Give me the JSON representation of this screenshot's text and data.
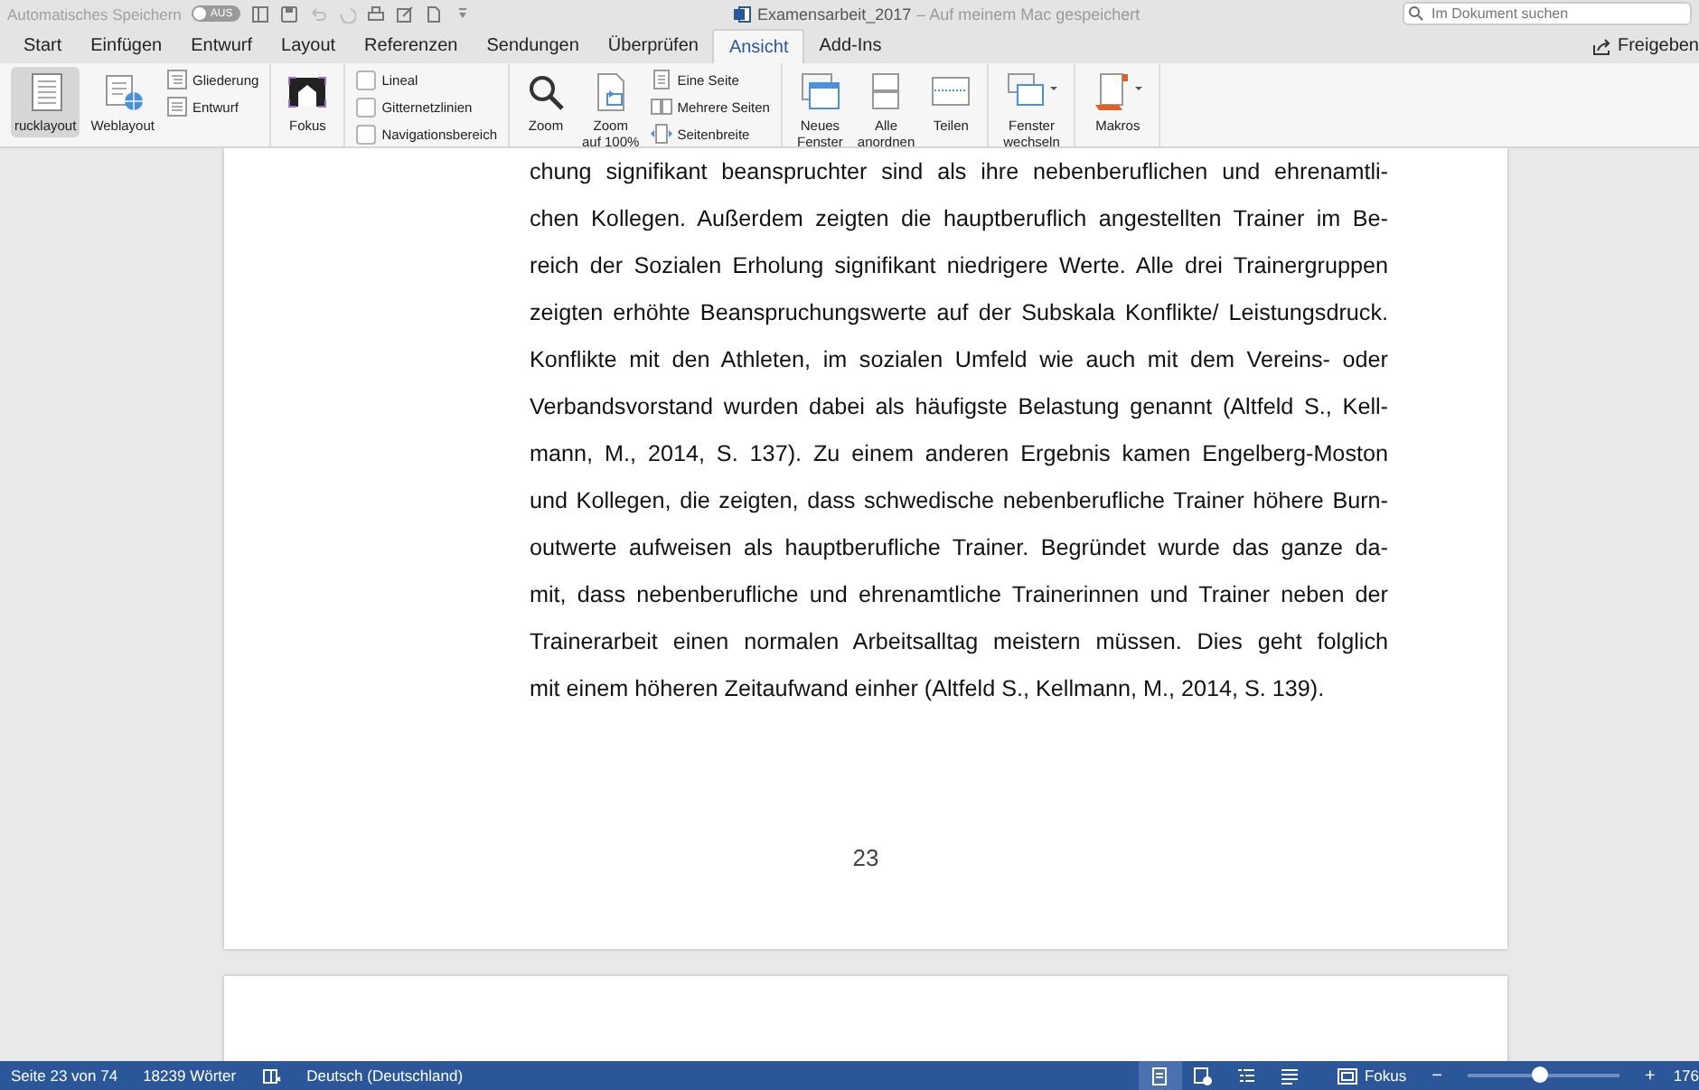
{
  "titlebar": {
    "autosave": {
      "label": "Automatisches Speichern",
      "toggle": "AUS",
      "on": false
    },
    "title": "Examensarbeit_2017",
    "subtitle": "– Auf meinem Mac gespeichert",
    "search": {
      "placeholder": "Im Dokument suchen"
    }
  },
  "tabs": [
    {
      "label": "Start",
      "selected": false
    },
    {
      "label": "Einfügen",
      "selected": false
    },
    {
      "label": "Entwurf",
      "selected": false
    },
    {
      "label": "Layout",
      "selected": false
    },
    {
      "label": "Referenzen",
      "selected": false
    },
    {
      "label": "Sendungen",
      "selected": false
    },
    {
      "label": "Überprüfen",
      "selected": false
    },
    {
      "label": "Ansicht",
      "selected": true
    },
    {
      "label": "Add-Ins",
      "selected": false
    }
  ],
  "share": "Freigeben",
  "ribbon": {
    "groups": [
      {
        "items": [
          {
            "kind": "large",
            "label": "rucklayout",
            "selected": true
          },
          {
            "kind": "large",
            "label": "Weblayout",
            "selected": false
          },
          {
            "kind": "small",
            "label": "Gliederung"
          },
          {
            "kind": "small",
            "label": "Entwurf"
          }
        ]
      },
      {
        "items": [
          {
            "kind": "large",
            "label": "Fokus",
            "selected": false
          }
        ]
      },
      {
        "items": [
          {
            "kind": "checkbox",
            "label": "Lineal",
            "checked": false
          },
          {
            "kind": "checkbox",
            "label": "Gitternetzlinien",
            "checked": false
          },
          {
            "kind": "checkbox",
            "label": "Navigationsbereich",
            "checked": false
          }
        ]
      },
      {
        "items": [
          {
            "kind": "large",
            "label": "Zoom",
            "selected": false
          },
          {
            "kind": "large",
            "label": "Zoom\nauf 100%",
            "selected": false
          },
          {
            "kind": "small",
            "label": "Eine Seite"
          },
          {
            "kind": "small",
            "label": "Mehrere Seiten"
          },
          {
            "kind": "small",
            "label": "Seitenbreite"
          }
        ]
      },
      {
        "items": [
          {
            "kind": "large",
            "label": "Neues\nFenster",
            "selected": false
          },
          {
            "kind": "large",
            "label": "Alle\nanordnen",
            "selected": false
          },
          {
            "kind": "large",
            "label": "Teilen",
            "selected": false
          }
        ]
      },
      {
        "items": [
          {
            "kind": "large",
            "label": "Fenster\nwechseln",
            "selected": false
          }
        ]
      },
      {
        "items": [
          {
            "kind": "large",
            "label": "Makros",
            "selected": false
          }
        ]
      }
    ]
  },
  "document": {
    "lines": [
      "chung signifikant beanspruchter sind als ihre nebenberuflichen und ehrenamtli-",
      "chen Kollegen. Außerdem zeigten die hauptberuflich angestellten Trainer im Be-",
      "reich der Sozialen Erholung signifikant niedrigere Werte. Alle drei Trainergruppen",
      "zeigten erhöhte Beanspruchungswerte auf der Subskala Konflikte/ Leistungsdruck.",
      "Konflikte mit den Athleten, im sozialen Umfeld wie auch mit dem Vereins- oder",
      "Verbandsvorstand wurden dabei als häufigste Belastung genannt (Altfeld S., Kell-",
      "mann, M., 2014, S. 137). Zu einem anderen Ergebnis kamen Engelberg-Moston",
      "und Kollegen, die zeigten, dass schwedische nebenberufliche Trainer höhere Burn-",
      "outwerte aufweisen als hauptberufliche Trainer. Begründet wurde das ganze da-",
      "mit, dass nebenberufliche und ehrenamtliche Trainerinnen und Trainer neben der",
      "Trainerarbeit einen normalen Arbeitsalltag meistern müssen. Dies geht folglich",
      "mit einem höheren Zeitaufwand einher (Altfeld S., Kellmann, M., 2014, S. 139)."
    ],
    "page_number": "23"
  },
  "status_bar": {
    "page": "Seite 23 von 74",
    "words": "18239 Wörter",
    "language": "Deutsch (Deutschland)",
    "views": [
      {
        "selected": true
      },
      {
        "selected": false
      },
      {
        "selected": false
      },
      {
        "selected": false
      }
    ],
    "focus": "Fokus",
    "zoom_out": "−",
    "zoom_in": "+",
    "zoom": {
      "level": 0.48
    },
    "zoom_value": "176"
  }
}
